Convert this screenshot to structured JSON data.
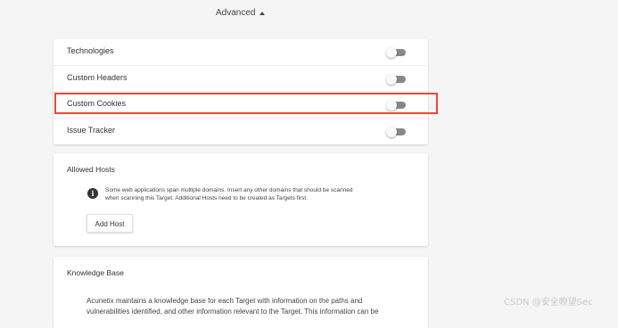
{
  "advanced": {
    "label": "Advanced"
  },
  "toggles": [
    {
      "label": "Technologies",
      "enabled": false
    },
    {
      "label": "Custom Headers",
      "enabled": false
    },
    {
      "label": "Custom Cookies",
      "enabled": false,
      "highlighted": true
    },
    {
      "label": "Issue Tracker",
      "enabled": false
    }
  ],
  "allowed_hosts": {
    "title": "Allowed Hosts",
    "info_line_1": "Some web applications span multiple domains. Insert any other domains that should be scanned",
    "info_line_2": "when scanning this Target. Additional Hosts need to be created as Targets first.",
    "button_label": "Add Host"
  },
  "knowledge_base": {
    "title": "Knowledge Base",
    "text_line_1": "Acunetix maintains a knowledge base for each Target with information on the paths and",
    "text_line_2": "vulnerabilities identified, and other information relevant to the Target. This information can be"
  },
  "watermark": "CSDN @安全瞭望Sec",
  "colors": {
    "highlight": "#e84b2f",
    "switch_track": "#888888",
    "background": "#f5f5f5"
  }
}
